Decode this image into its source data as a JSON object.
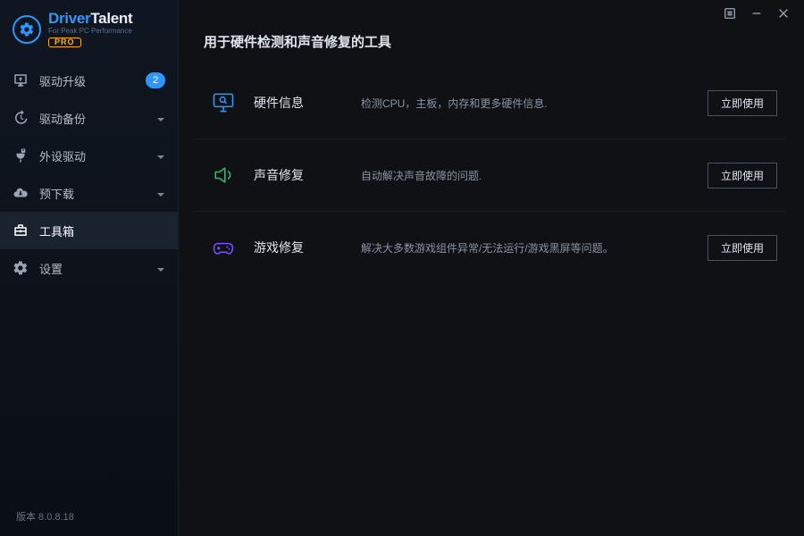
{
  "logo": {
    "word1": "Driver",
    "word2": "Talent",
    "subtitle": "For Peak PC Performance",
    "pro": "PRO"
  },
  "sidebar": {
    "items": [
      {
        "label": "驱动升级",
        "badge": "2"
      },
      {
        "label": "驱动备份"
      },
      {
        "label": "外设驱动"
      },
      {
        "label": "预下载"
      },
      {
        "label": "工具箱"
      },
      {
        "label": "设置"
      }
    ]
  },
  "version_label": "版本 8.0.8.18",
  "page": {
    "title": "用于硬件检测和声音修复的工具"
  },
  "tools": [
    {
      "name": "硬件信息",
      "desc": "检测CPU，主板，内存和更多硬件信息.",
      "action": "立即使用"
    },
    {
      "name": "声音修复",
      "desc": "自动解决声音故障的问题.",
      "action": "立即使用"
    },
    {
      "name": "游戏修复",
      "desc": "解决大多数游戏组件异常/无法运行/游戏黑屏等问题。",
      "action": "立即使用"
    }
  ]
}
